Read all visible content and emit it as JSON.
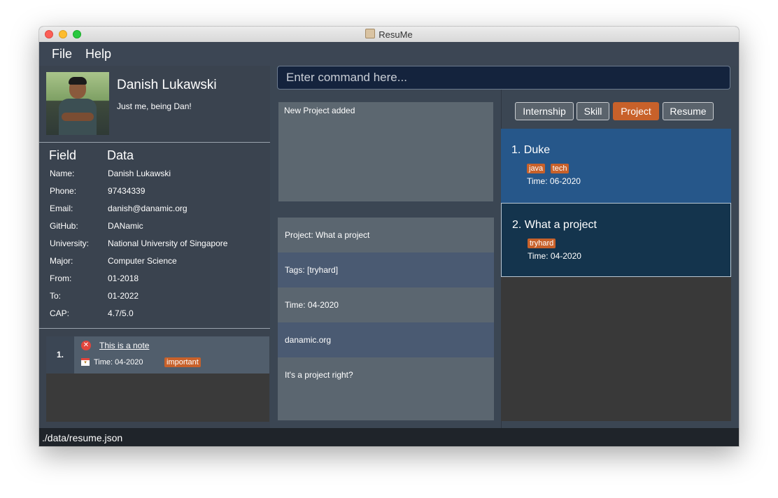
{
  "window": {
    "title": "ResuMe"
  },
  "menu": {
    "file": "File",
    "help": "Help"
  },
  "profile": {
    "name": "Danish Lukawski",
    "tagline": "Just me, being Dan!",
    "field_header": "Field",
    "data_header": "Data",
    "fields": [
      {
        "key": "Name:",
        "value": "Danish Lukawski"
      },
      {
        "key": "Phone:",
        "value": "97434339"
      },
      {
        "key": "Email:",
        "value": "danish@danamic.org"
      },
      {
        "key": "GitHub:",
        "value": "DANamic"
      },
      {
        "key": "University:",
        "value": "National University of Singapore"
      },
      {
        "key": "Major:",
        "value": "Computer Science"
      },
      {
        "key": "From:",
        "value": "01-2018"
      },
      {
        "key": "To:",
        "value": "01-2022"
      },
      {
        "key": "CAP:",
        "value": "4.7/5.0"
      }
    ]
  },
  "notes": [
    {
      "index": "1.",
      "title": "This is a note",
      "time": "Time:  04-2020",
      "tag": "important"
    }
  ],
  "command": {
    "placeholder": "Enter command here..."
  },
  "result": {
    "text": "New Project added"
  },
  "detail": {
    "rows": [
      "Project: What a project",
      "Tags: [tryhard]",
      "Time: 04-2020",
      "danamic.org",
      "It's a project right?"
    ]
  },
  "tabs": [
    "Internship",
    "Skill",
    "Project",
    "Resume"
  ],
  "active_tab": "Project",
  "items": [
    {
      "title": "1.  Duke",
      "tags": [
        "java",
        "tech"
      ],
      "time": "Time: 06-2020"
    },
    {
      "title": "2.  What a project",
      "tags": [
        "tryhard"
      ],
      "time": "Time: 04-2020"
    }
  ],
  "status": {
    "path": "./data/resume.json"
  },
  "colors": {
    "accent": "#c8612a",
    "selected_card": "#26578a",
    "card": "#14344d",
    "background": "#3b4653"
  }
}
